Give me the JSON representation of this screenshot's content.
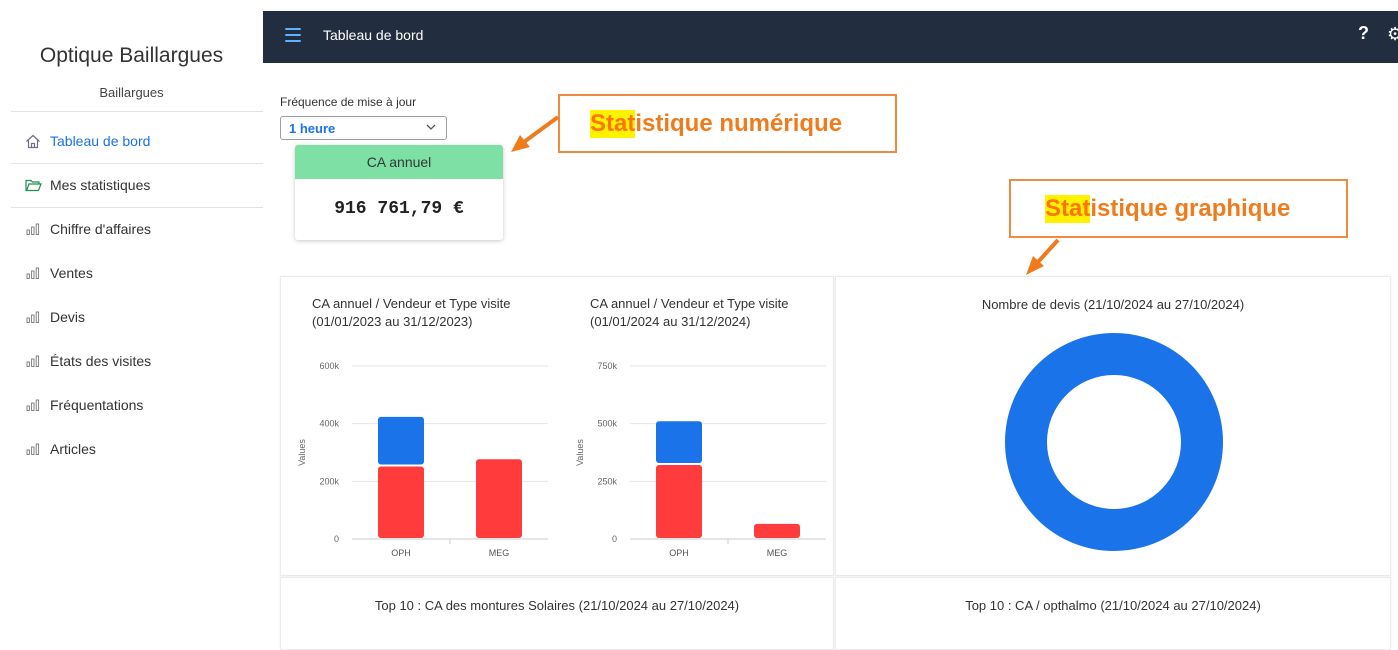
{
  "sidebar": {
    "brand": "Optique Baillargues",
    "subtitle": "Baillargues",
    "items": [
      {
        "label": "Tableau de bord",
        "icon": "home-icon",
        "active": true
      },
      {
        "label": "Mes statistiques",
        "icon": "folder-icon"
      },
      {
        "label": "Chiffre d'affaires",
        "icon": "bar-chart-icon"
      },
      {
        "label": "Ventes",
        "icon": "bar-chart-icon"
      },
      {
        "label": "Devis",
        "icon": "bar-chart-icon"
      },
      {
        "label": "États des visites",
        "icon": "bar-chart-icon"
      },
      {
        "label": "Fréquentations",
        "icon": "bar-chart-icon"
      },
      {
        "label": "Articles",
        "icon": "bar-chart-icon"
      }
    ]
  },
  "topbar": {
    "title": "Tableau de bord",
    "help": "?",
    "gear": "⚙"
  },
  "frequency": {
    "label": "Fréquence de mise à jour",
    "value": "1 heure"
  },
  "kpi": {
    "title": "CA annuel",
    "value": "916 761,79 €"
  },
  "annotations": {
    "numeric": {
      "highlight": "Stat",
      "rest": "istique numérique"
    },
    "graphic": {
      "highlight": "Stat",
      "rest": "istique graphique"
    }
  },
  "colors": {
    "topbar": "#222e3f",
    "accent": "#1a73e8",
    "kpi_header": "#7fe0a5",
    "annotation": "#f07b1d",
    "highlight": "#fff200",
    "bar_blue": "#1a73e8",
    "bar_red": "#ff3b3b"
  },
  "chart_data": [
    {
      "type": "bar",
      "stacked": true,
      "title": "CA annuel / Vendeur et Type visite (01/01/2023 au 31/12/2023)",
      "ylabel": "Values",
      "ylim": [
        0,
        600000
      ],
      "yticks": [
        0,
        200000,
        400000,
        600000
      ],
      "ytick_labels": [
        "0",
        "200k",
        "400k",
        "600k"
      ],
      "categories": [
        "OPH",
        "MEG"
      ],
      "series": [
        {
          "color": "#ff3b3b",
          "values": [
            255000,
            280000
          ]
        },
        {
          "color": "#1a73e8",
          "values": [
            172000,
            0
          ]
        }
      ]
    },
    {
      "type": "bar",
      "stacked": true,
      "title": "CA annuel / Vendeur et Type visite (01/01/2024 au 31/12/2024)",
      "ylabel": "Values",
      "ylim": [
        0,
        750000
      ],
      "yticks": [
        0,
        250000,
        500000,
        750000
      ],
      "ytick_labels": [
        "0",
        "250k",
        "500k",
        "750k"
      ],
      "categories": [
        "OPH",
        "MEG"
      ],
      "series": [
        {
          "color": "#ff3b3b",
          "values": [
            325000,
            70000
          ]
        },
        {
          "color": "#1a73e8",
          "values": [
            190000,
            0
          ]
        }
      ]
    },
    {
      "type": "pie",
      "donut": true,
      "title": "Nombre de devis (21/10/2024 au 27/10/2024)",
      "slices": [
        {
          "value": 1,
          "color": "#1a73e8"
        }
      ]
    }
  ],
  "bottom_panels": [
    {
      "title": "Top 10 : CA des montures Solaires (21/10/2024 au 27/10/2024)"
    },
    {
      "title": "Top 10 : CA / opthalmo (21/10/2024 au 27/10/2024)"
    }
  ]
}
